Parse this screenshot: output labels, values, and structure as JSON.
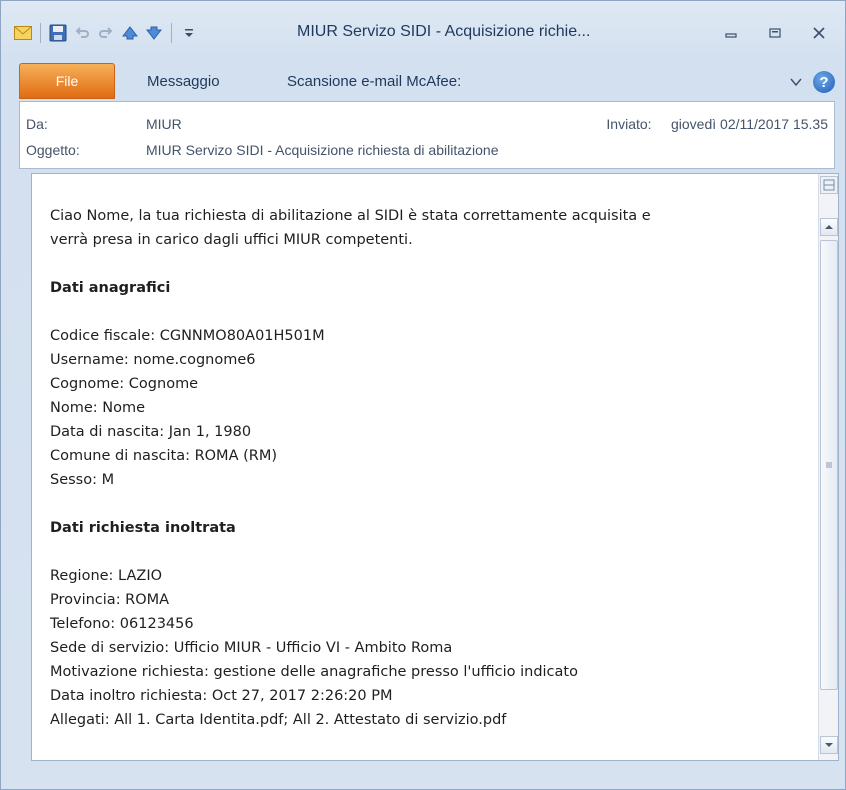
{
  "window": {
    "title": "MIUR Servizo SIDI - Acquisizione richie...",
    "icons": [
      "mail-icon",
      "save-icon",
      "undo-icon",
      "redo-icon",
      "previous-item-icon",
      "next-item-icon",
      "customize-toolbar-icon"
    ]
  },
  "ribbon": {
    "tabs": [
      "File",
      "Messaggio",
      "Scansione e-mail McAfee:"
    ],
    "help": "?"
  },
  "header": {
    "from_label": "Da:",
    "from_value": "MIUR",
    "sent_label": "Inviato:",
    "sent_value": "giovedì 02/11/2017 15.35",
    "subject_label": "Oggetto:",
    "subject_value": "MIUR Servizo SIDI - Acquisizione richiesta di abilitazione"
  },
  "body": {
    "intro_line1": "Ciao Nome, la tua richiesta di abilitazione al SIDI è stata correttamente acquisita e",
    "intro_line2": "verrà presa in carico dagli uffici MIUR competenti.",
    "section1_title": "Dati anagrafici",
    "section1_lines": [
      "Codice fiscale: CGNNMO80A01H501M",
      "Username: nome.cognome6",
      "Cognome: Cognome",
      "Nome: Nome",
      "Data di nascita: Jan 1, 1980",
      "Comune di nascita: ROMA (RM)",
      "Sesso: M"
    ],
    "section2_title": "Dati richiesta inoltrata",
    "section2_lines": [
      "Regione: LAZIO",
      "Provincia: ROMA",
      "Telefono: 06123456",
      "Sede di servizio: Ufficio MIUR - Ufficio VI - Ambito Roma",
      "Motivazione richiesta: gestione delle anagrafiche presso l'ufficio indicato",
      "Data inoltro richiesta: Oct 27, 2017 2:26:20 PM",
      "Allegati: All 1. Carta Identita.pdf; All 2. Attestato di servizio.pdf"
    ]
  },
  "colors": {
    "file_tab": "#e06c12",
    "title_text": "#1e395b",
    "help_button": "#1f5db8"
  }
}
